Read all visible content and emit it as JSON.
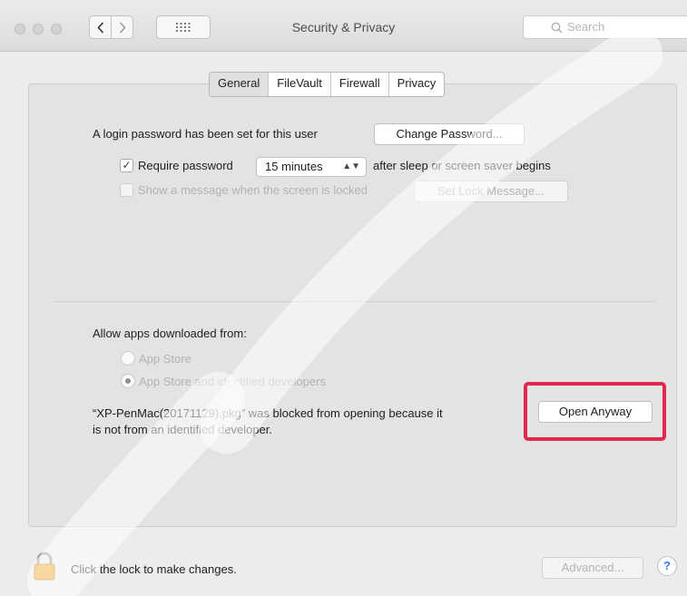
{
  "window": {
    "title": "Security & Privacy",
    "search_placeholder": "Search"
  },
  "tabs": [
    "General",
    "FileVault",
    "Firewall",
    "Privacy"
  ],
  "active_tab": "General",
  "general": {
    "password_text": "A login password has been set for this user",
    "change_password_label": "Change Password...",
    "require_password_label": "Require password",
    "require_password_checked": true,
    "require_password_delay": "15 minutes",
    "after_sleep_text": "after sleep or screen saver begins",
    "show_message_label": "Show a message when the screen is locked",
    "show_message_checked": false,
    "set_lock_message_label": "Set Lock Message..."
  },
  "apps": {
    "allow_heading": "Allow apps downloaded from:",
    "option_app_store": "App Store",
    "option_identified": "App Store and identified developers",
    "selected_option": "App Store and identified developers",
    "blocked_message_line1": "“XP-PenMac(20171129).pkg” was blocked from opening because it",
    "blocked_message_line2": "is not from an identified developer.",
    "open_anyway_label": "Open Anyway"
  },
  "footer": {
    "lock_text": "Click the lock to make changes.",
    "advanced_label": "Advanced...",
    "help_label": "?"
  },
  "colors": {
    "highlight_border": "#e3264b",
    "help_accent": "#3478f6"
  }
}
